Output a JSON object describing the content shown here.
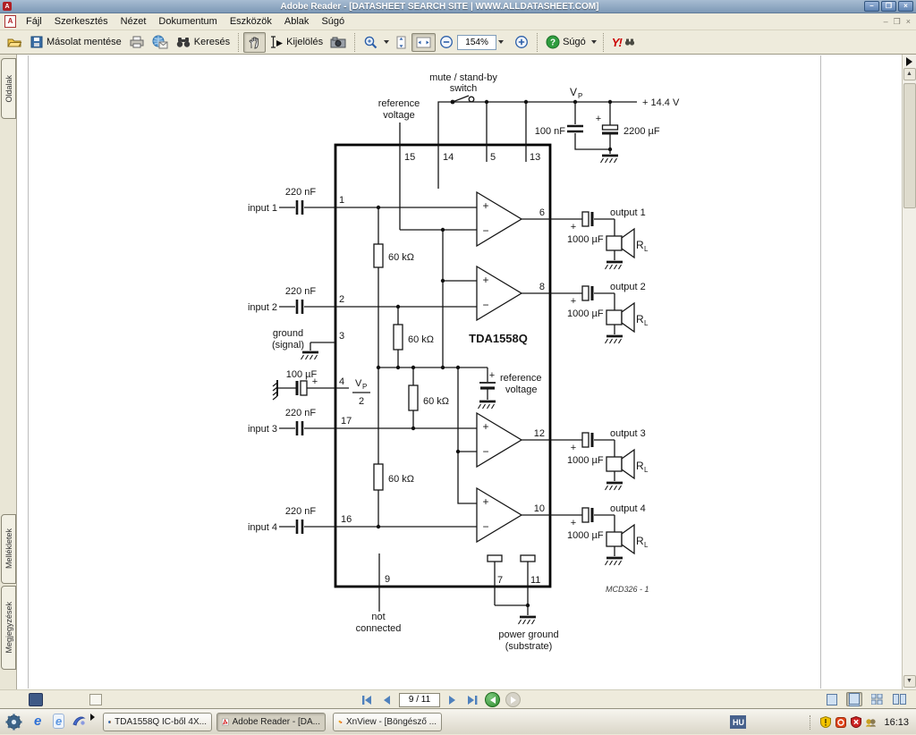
{
  "colors": {
    "titlebar": "#7e99b6",
    "accent_blue": "#4f81bd",
    "help_green": "#2f9c3e",
    "yahoo_red": "#cc0000",
    "taskbar": "#dad6c8"
  },
  "window": {
    "title": "Adobe Reader - [DATASHEET SEARCH SITE | WWW.ALLDATASHEET.COM]",
    "controls": {
      "minimize": "–",
      "restore": "❒",
      "close": "×"
    }
  },
  "mdi": {
    "minimize": "–",
    "restore": "❒",
    "close": "×"
  },
  "menu": {
    "items": [
      "Fájl",
      "Szerkesztés",
      "Nézet",
      "Dokumentum",
      "Eszközök",
      "Ablak",
      "Súgó"
    ]
  },
  "toolbar": {
    "save_label": "Másolat mentése",
    "search_label": "Keresés",
    "select_label": "Kijelölés",
    "zoom_value": "154%",
    "help_label": "Súgó",
    "help_qmark": "?",
    "yahoo_label": "Y!"
  },
  "sidebar": {
    "tabs": [
      "Oldalak",
      "Mellékletek",
      "Megjegyzések"
    ]
  },
  "statusbar": {
    "page_indicator": "9 / 11"
  },
  "taskbar": {
    "buttons": [
      {
        "label": "TDA1558Q IC-ből 4X..."
      },
      {
        "label": "Adobe Reader - [DA..."
      },
      {
        "label": "XnView - [Böngésző ..."
      }
    ],
    "tray": {
      "lang": "HU",
      "time": "16:13"
    }
  },
  "diagram": {
    "ic_name": "TDA1558Q",
    "code": "MCD326 - 1",
    "plus": "+",
    "top": {
      "mute1": "mute / stand-by",
      "mute2": "switch",
      "ref1": "reference",
      "ref2": "voltage",
      "v": "V",
      "v_sub": "P",
      "supply": "+ 14.4 V",
      "cap1": "100 nF",
      "cap2": "2200 µF",
      "pin15": "15",
      "pin14": "14",
      "pin5": "5",
      "pin13": "13"
    },
    "inputs": [
      {
        "label": "input 1",
        "cap": "220 nF",
        "pin": "1"
      },
      {
        "label": "input 2",
        "cap": "220 nF",
        "pin": "2"
      },
      {
        "label": "input 3",
        "cap": "220 nF",
        "pin": "17"
      },
      {
        "label": "input 4",
        "cap": "220 nF",
        "pin": "16"
      }
    ],
    "ground_signal": {
      "l1": "ground",
      "l2": "(signal)",
      "pin": "3"
    },
    "half_supply": {
      "cap": "100 µF",
      "pin": "4",
      "v": "V",
      "v_sub": "P",
      "den": "2"
    },
    "resistors": [
      {
        "label": "60 kΩ"
      },
      {
        "label": "60 kΩ"
      },
      {
        "label": "60 kΩ"
      },
      {
        "label": "60 kΩ"
      }
    ],
    "ref_internal": {
      "l1": "reference",
      "l2": "voltage"
    },
    "opamp": {
      "plus": "+",
      "minus": "−"
    },
    "outputs": [
      {
        "pin": "6",
        "label": "output 1",
        "cap": "1000 µF",
        "load": "R",
        "load_sub": "L"
      },
      {
        "pin": "8",
        "label": "output 2",
        "cap": "1000 µF",
        "load": "R",
        "load_sub": "L"
      },
      {
        "pin": "12",
        "label": "output 3",
        "cap": "1000 µF",
        "load": "R",
        "load_sub": "L"
      },
      {
        "pin": "10",
        "label": "output 4",
        "cap": "1000 µF",
        "load": "R",
        "load_sub": "L"
      }
    ],
    "bottom": {
      "nc_pin": "9",
      "nc1": "not",
      "nc2": "connected",
      "pin7": "7",
      "pin11": "11",
      "pg1": "power ground",
      "pg2": "(substrate)"
    }
  }
}
